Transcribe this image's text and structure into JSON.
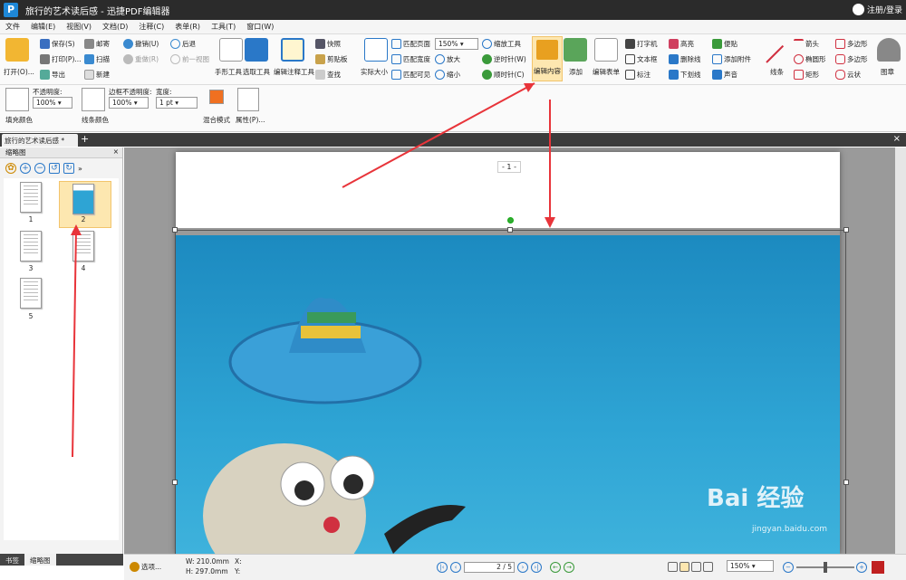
{
  "window": {
    "title": "旅行的艺术读后感 - 迅捷PDF编辑器",
    "app_icon": "P",
    "user_label": "注册/登录"
  },
  "menu": [
    "文件",
    "编辑(E)",
    "视图(V)",
    "文档(D)",
    "注释(C)",
    "表单(R)",
    "工具(T)",
    "窗口(W)"
  ],
  "ribbon": {
    "open": "打开(O)...",
    "save": "保存(S)",
    "print": "打印(P)...",
    "export": "导出",
    "mail": "邮寄",
    "scan": "扫描",
    "new": "新建",
    "undo": "撤销(U)",
    "redo": "重做(R)",
    "back": "后退",
    "forward": "前一视图",
    "hand_tool": "手形工具",
    "select_tool": "选取工具",
    "edit_annot": "编辑注释工具",
    "snapshot": "快照",
    "clipboard": "剪贴板",
    "find": "查找",
    "actual_size": "实际大小",
    "fit_page": "匹配页面",
    "fit_width": "匹配宽度",
    "fit_visible": "匹配可见",
    "zoom_value": "150%",
    "zoom_tool": "缩放工具",
    "zoom_in": "放大",
    "zoom_out": "缩小",
    "rotate_ccw": "逆时针(W)",
    "rotate_cw": "顺时针(C)",
    "edit_content": "编辑内容",
    "add": "添加",
    "edit_form": "编辑表单",
    "typewriter": "打字机",
    "textbox": "文本框",
    "callout": "标注",
    "highlight": "高亮",
    "strikeout": "删除线",
    "underline": "下划线",
    "sticky": "便贴",
    "attach": "添加附件",
    "sound": "声音",
    "line": "线条",
    "arrow": "箭头",
    "ellipse": "椭圆形",
    "rect": "矩形",
    "polygon": "多边形",
    "polyline": "多边形",
    "cloud": "云状",
    "stamp": "图章"
  },
  "ribbon2": {
    "opacity_label": "不透明度:",
    "opacity_value": "100%",
    "border_opacity_label": "边框不透明度:",
    "border_opacity_value": "100%",
    "width_label": "宽度:",
    "width_value": "1 pt",
    "fill_color": "填充颜色",
    "line_color": "线条颜色",
    "blend_mode": "混合模式",
    "properties": "属性(P)..."
  },
  "tabs": {
    "doc_tab": "旅行的艺术读后感 *",
    "add": "+",
    "close": "×"
  },
  "sidebar": {
    "title": "缩略图",
    "close": "×",
    "pages": [
      "1",
      "2",
      "3",
      "4",
      "5"
    ],
    "selected": "2",
    "bottom_tabs": [
      "书签",
      "缩略图"
    ]
  },
  "document": {
    "page_number": "- 1 -"
  },
  "statusbar": {
    "options": "选项...",
    "width": "W: 210.0mm",
    "height": "H: 297.0mm",
    "x": "X:",
    "y": "Y:",
    "page_input": "2 / 5",
    "zoom": "150%"
  },
  "watermark": {
    "brand": "Bai 经验",
    "url": "jingyan.baidu.com"
  },
  "colors": {
    "accent": "#2a78c8",
    "titlebar": "#2b2b2b",
    "arrow": "#e8343a",
    "photo": "#2ea4d4"
  }
}
